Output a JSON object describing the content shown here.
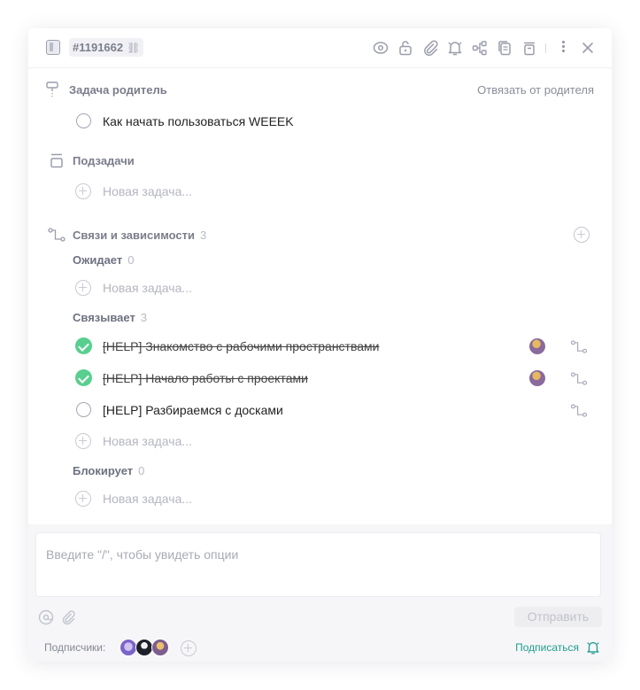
{
  "header": {
    "task_id": "#1191662"
  },
  "parent": {
    "title": "Задача родитель",
    "unlink_label": "Отвязать от родителя",
    "task": "Как начать пользоваться WEEEK"
  },
  "subtasks": {
    "title": "Подзадачи",
    "new_task": "Новая задача..."
  },
  "links": {
    "title": "Связи и зависимости",
    "count": "3",
    "waiting": {
      "label": "Ожидает",
      "count": "0",
      "new_task": "Новая задача..."
    },
    "relates": {
      "label": "Связывает",
      "count": "3",
      "items": [
        {
          "text": "[HELP] Знакомство с рабочими пространствами",
          "done": true
        },
        {
          "text": "[HELP] Начало работы с проектами",
          "done": true
        },
        {
          "text": "[HELP] Разбираемся с досками",
          "done": false
        }
      ],
      "new_task": "Новая задача..."
    },
    "blocks": {
      "label": "Блокирует",
      "count": "0",
      "new_task": "Новая задача..."
    }
  },
  "comment": {
    "placeholder": "Введите \"/\", чтобы увидеть опции",
    "send_label": "Отправить"
  },
  "subscribers": {
    "label": "Подписчики:",
    "subscribe_label": "Подписаться"
  },
  "colors": {
    "accent_green": "#58cf8f",
    "subscribe_teal": "#1f9e8f"
  }
}
